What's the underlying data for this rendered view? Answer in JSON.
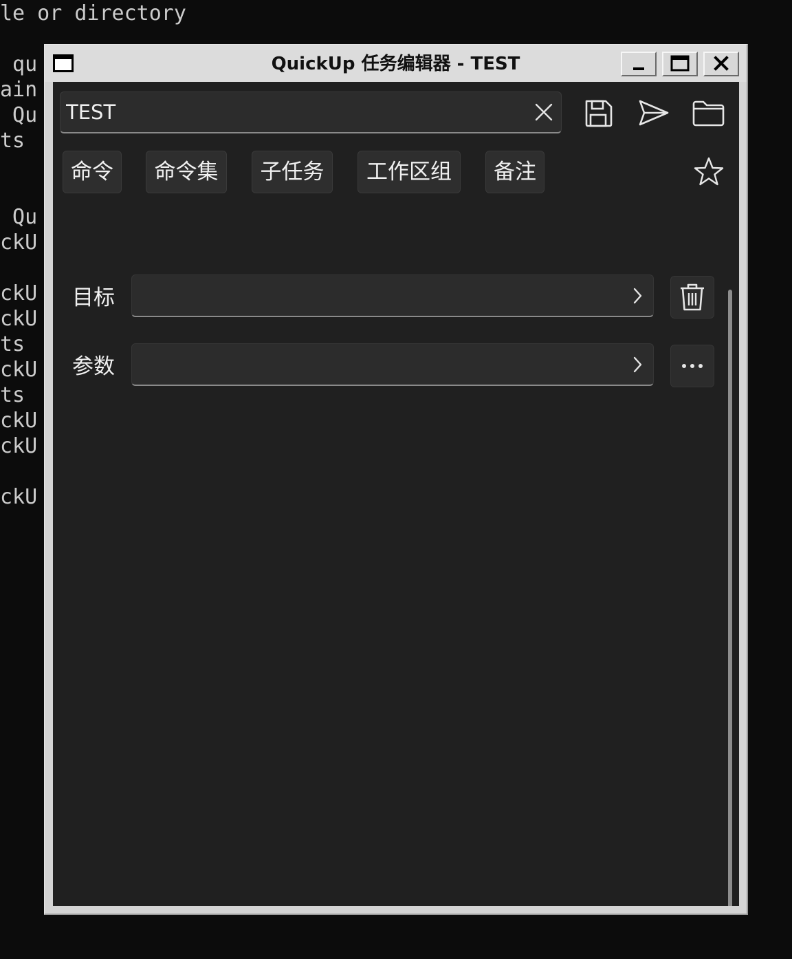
{
  "terminal": {
    "lines": [
      {
        "id": "line-1",
        "text": "le or directory"
      },
      {
        "id": "line-2",
        "text": " qu"
      },
      {
        "id": "line-3",
        "text": "ain"
      },
      {
        "id": "line-4",
        "text": " Qu"
      },
      {
        "id": "line-5",
        "text": "ts"
      },
      {
        "id": "line-6",
        "text": " Qu"
      },
      {
        "id": "line-7",
        "text": "ckU"
      },
      {
        "id": "line-8",
        "text": "ckU"
      },
      {
        "id": "line-9",
        "text": "ckU"
      },
      {
        "id": "line-10",
        "text": "ts"
      },
      {
        "id": "line-11",
        "text": "ckU"
      },
      {
        "id": "line-12",
        "text": "ts"
      },
      {
        "id": "line-13",
        "text": "ckU"
      },
      {
        "id": "line-14",
        "text": "ckU"
      },
      {
        "id": "line-15",
        "text": "ckU"
      }
    ]
  },
  "window": {
    "title": "QuickUp 任务编辑器 - TEST",
    "controls": {
      "minimize_icon": "minimize-icon",
      "maximize_icon": "maximize-icon",
      "close_icon": "close-icon"
    }
  },
  "editor": {
    "task_name": {
      "value": "TEST",
      "placeholder": ""
    },
    "toolbar": {
      "clear_icon": "close-icon",
      "save_icon": "save-icon",
      "send_icon": "send-icon",
      "folder_icon": "folder-icon"
    },
    "tabs": [
      {
        "label": "命令"
      },
      {
        "label": "命令集"
      },
      {
        "label": "子任务"
      },
      {
        "label": "工作区组"
      },
      {
        "label": "备注"
      }
    ],
    "favorite_icon": "star-icon",
    "rows": {
      "target": {
        "label": "目标",
        "value": "",
        "action_icon": "trash-icon"
      },
      "params": {
        "label": "参数",
        "value": "",
        "action_icon": "more-icon"
      }
    }
  },
  "colors": {
    "window_bg": "#202020",
    "field_bg": "#2c2c2c",
    "text": "#f0f0f0",
    "frame": "#d4d4d4"
  }
}
